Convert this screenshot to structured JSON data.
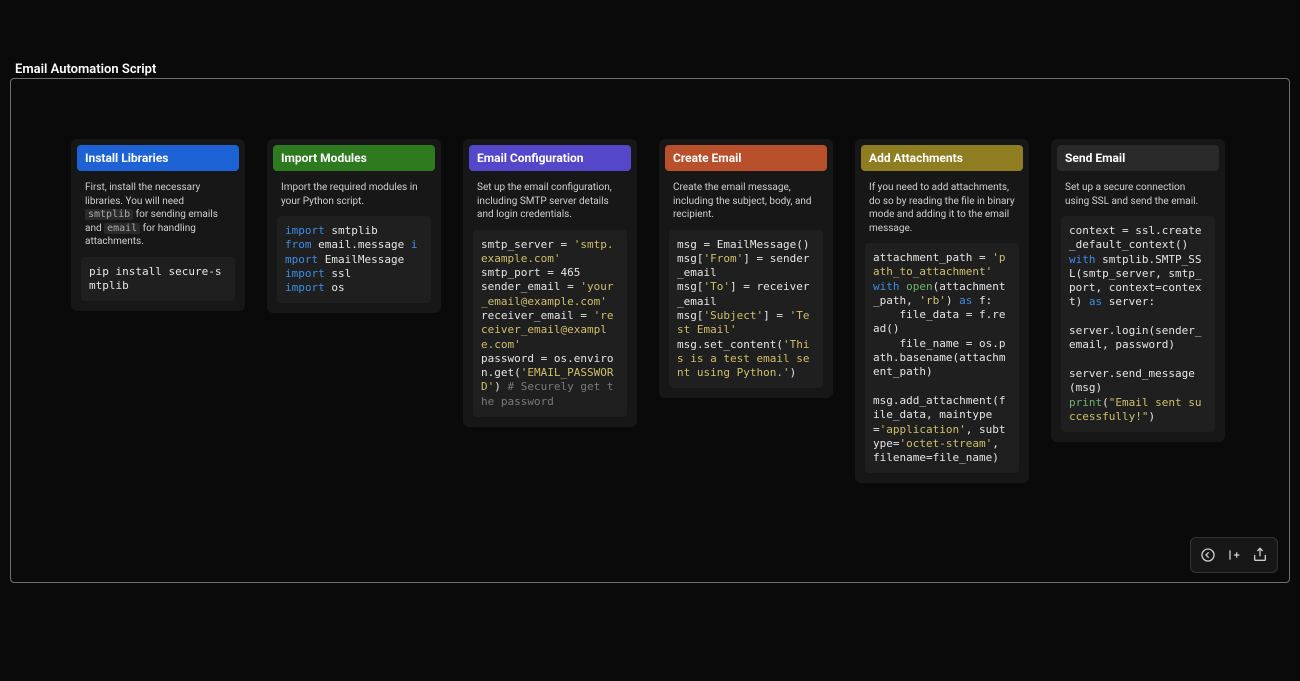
{
  "page": {
    "title": "Email Automation Script"
  },
  "cards": [
    {
      "title": "Install Libraries",
      "headerClass": "hdr-blue",
      "desc_html": "First, install the necessary libraries. You will need <code>smtplib</code> for sending emails and <code>email</code> for handling attachments.",
      "code_html": "pip install secure-smtplib"
    },
    {
      "title": "Import Modules",
      "headerClass": "hdr-green",
      "desc_html": "Import the required modules in your Python script.",
      "code_html": "<span class=\"kw\">import</span> smtplib\n<span class=\"kw\">from</span> email.message <span class=\"kw\">import</span> EmailMessage\n<span class=\"kw\">import</span> ssl\n<span class=\"kw\">import</span> os"
    },
    {
      "title": "Email Configuration",
      "headerClass": "hdr-purple",
      "desc_html": "Set up the email configuration, including SMTP server details and login credentials.",
      "code_html": "smtp_server = <span class=\"str\">'smtp.example.com'</span>\nsmtp_port = 465\nsender_email = <span class=\"str\">'your_email@example.com'</span>\nreceiver_email = <span class=\"str\">'receiver_email@example.com'</span>\npassword = os.environ.get(<span class=\"str\">'EMAIL_PASSWORD'</span>) <span class=\"cmt\"># Securely get the password</span>"
    },
    {
      "title": "Create Email",
      "headerClass": "hdr-orange",
      "desc_html": "Create the email message, including the subject, body, and recipient.",
      "code_html": "msg = EmailMessage()\nmsg[<span class=\"str\">'From'</span>] = sender_email\nmsg[<span class=\"str\">'To'</span>] = receiver_email\nmsg[<span class=\"str\">'Subject'</span>] = <span class=\"str\">'Test Email'</span>\nmsg.set_content(<span class=\"str\">'This is a test email sent using Python.'</span>)"
    },
    {
      "title": "Add Attachments",
      "headerClass": "hdr-olive",
      "desc_html": "If you need to add attachments, do so by reading the file in binary mode and adding it to the email message.",
      "code_html": "attachment_path = <span class=\"str\">'path_to_attachment'</span>\n<span class=\"kw\">with</span> <span class=\"fn\">open</span>(attachment_path, <span class=\"str\">'rb'</span>) <span class=\"kw\">as</span> f:\n    file_data = f.read()\n    file_name = os.path.basename(attachment_path)\n\nmsg.add_attachment(file_data, maintype=<span class=\"str\">'application'</span>, subtype=<span class=\"str\">'octet-stream'</span>, filename=file_name)"
    },
    {
      "title": "Send Email",
      "headerClass": "hdr-dark",
      "desc_html": "Set up a secure connection using SSL and send the email.",
      "code_html": "context = ssl.create_default_context()\n<span class=\"kw\">with</span> smtplib.SMTP_SSL(smtp_server, smtp_port, context=context) <span class=\"kw\">as</span> server:\n\nserver.login(sender_email, password)\n\nserver.send_message(msg)\n<span class=\"fn\">print</span>(<span class=\"str\">\"Email sent successfully!\"</span>)"
    }
  ],
  "toolbar": {
    "back": "back-icon",
    "add": "add-step-icon",
    "share": "share-icon"
  }
}
